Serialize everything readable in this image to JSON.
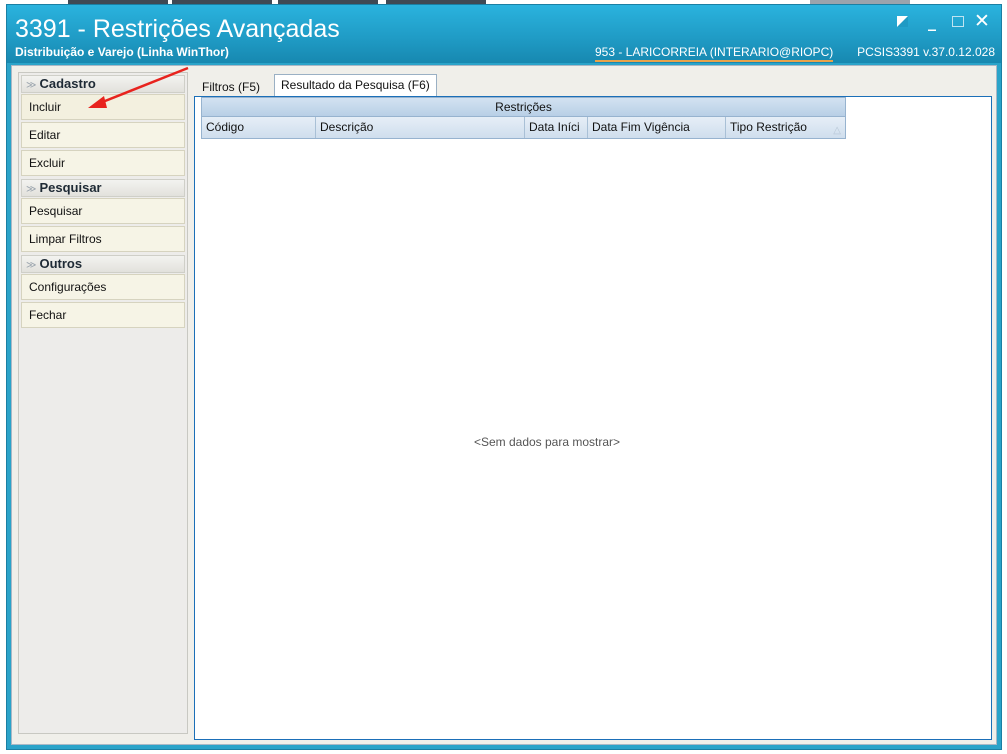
{
  "window": {
    "title": "3391 - Restrições Avançadas",
    "subtitle": "Distribuição e Varejo (Linha WinThor)",
    "user_info": "953 - LARICORREIA (INTERARIO@RIOPC)",
    "version_info": "PCSIS3391  v.37.0.12.028"
  },
  "sidebar": {
    "groups": [
      {
        "label": "Cadastro",
        "items": [
          "Incluir",
          "Editar",
          "Excluir"
        ]
      },
      {
        "label": "Pesquisar",
        "items": [
          "Pesquisar",
          "Limpar Filtros"
        ]
      },
      {
        "label": "Outros",
        "items": [
          "Configurações",
          "Fechar"
        ]
      }
    ]
  },
  "tabs": [
    {
      "label": "Filtros (F5)",
      "active": false
    },
    {
      "label": "Resultado da Pesquisa (F6)",
      "active": true
    }
  ],
  "grid": {
    "band": "Restrições",
    "columns": [
      "Código",
      "Descrição",
      "Data Iníci",
      "Data Fim Vigência",
      "Tipo Restrição"
    ],
    "empty_message": "<Sem dados para mostrar>"
  },
  "colors": {
    "titlebar": "#1f9ac4",
    "annotation_arrow": "#e8231e",
    "panel_border": "#1b6fb8"
  }
}
